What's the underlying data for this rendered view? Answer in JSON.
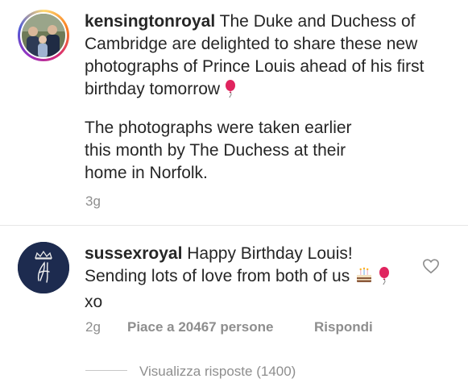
{
  "post": {
    "username": "kensingtonroyal",
    "caption_p1": "The Duke and Duchess of Cambridge are delighted to share these new photographs of Prince Louis ahead of his first birthday tomorrow",
    "caption_p2": "The photographs were taken earlier this month by The Duchess at their home in Norfolk.",
    "time": "3g",
    "emoji": "balloon-icon"
  },
  "comment": {
    "username": "sussexroyal",
    "text_main": "Happy Birthday Louis! Sending lots of love from both of us",
    "text_end": "xo",
    "time": "2g",
    "likes": "Piace a 20467 persone",
    "reply": "Rispondi",
    "view_replies": "Visualizza risposte (1400)",
    "icons": [
      "cake-icon",
      "balloon-icon",
      "heart-icon"
    ]
  },
  "colors": {
    "text": "#262626",
    "meta": "#8e8e8e",
    "balloon": "#e0245e",
    "sussex_avatar_bg": "#1d2b4f"
  }
}
